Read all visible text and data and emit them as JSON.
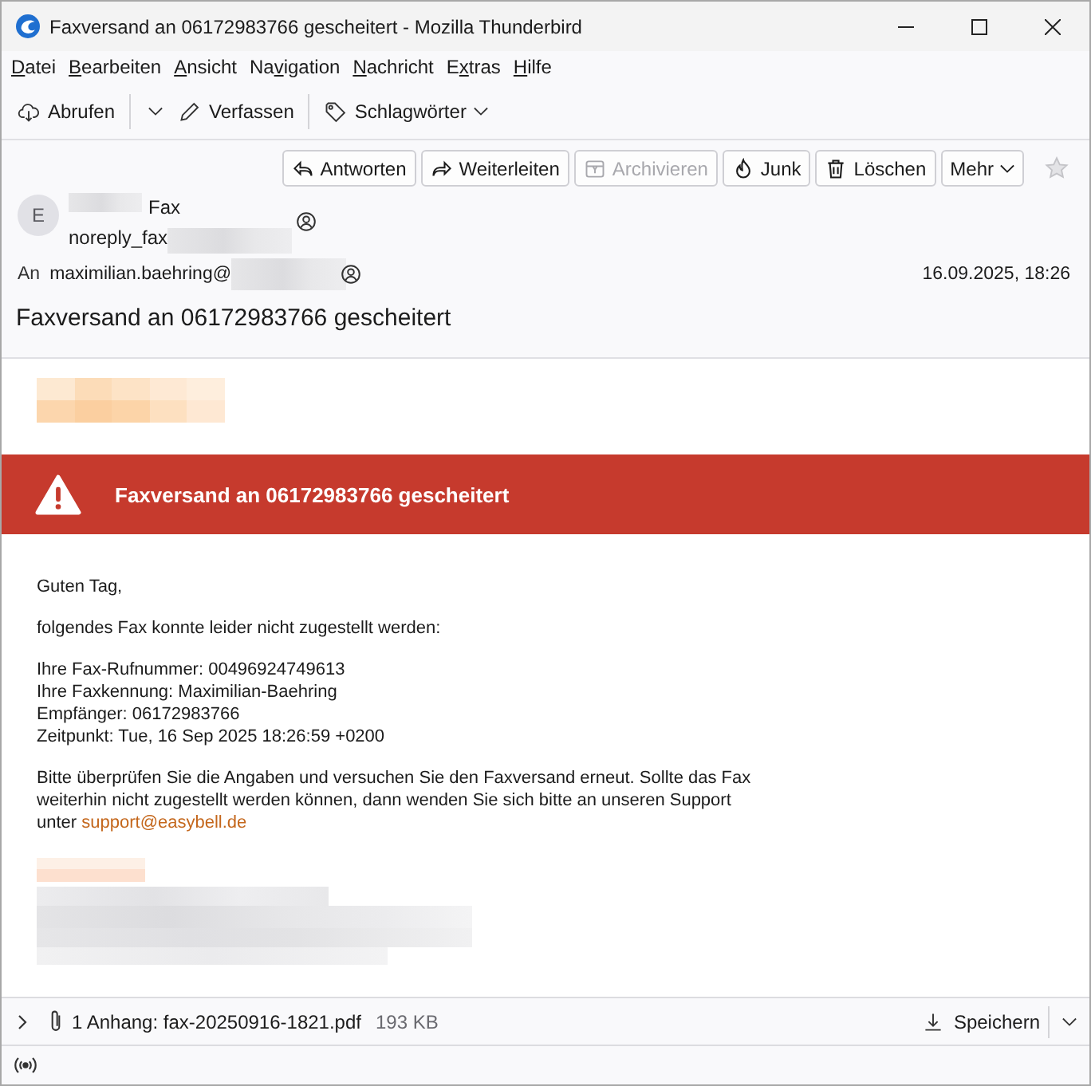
{
  "window": {
    "title": "Faxversand an 06172983766 gescheitert - Mozilla Thunderbird"
  },
  "menu": [
    {
      "key": "D",
      "after": "atei"
    },
    {
      "key": "B",
      "after": "earbeiten"
    },
    {
      "key": "A",
      "after": "nsicht"
    },
    {
      "before": "Na",
      "key": "v",
      "after": "igation"
    },
    {
      "key": "N",
      "after": "achricht"
    },
    {
      "before": "E",
      "key": "x",
      "after": "tras"
    },
    {
      "key": "H",
      "after": "ilfe"
    }
  ],
  "toolbar": [
    {
      "kind": "get",
      "label": "Abrufen"
    },
    {
      "kind": "compose",
      "label": "Verfassen"
    },
    {
      "kind": "tags",
      "label": "Schlagwörter"
    }
  ],
  "header": {
    "actions": [
      {
        "kind": "reply",
        "label": "Antworten",
        "disabled": false
      },
      {
        "kind": "forward",
        "label": "Weiterleiten",
        "disabled": false
      },
      {
        "kind": "archive",
        "label": "Archivieren",
        "disabled": true
      },
      {
        "kind": "junk",
        "label": "Junk",
        "disabled": false
      },
      {
        "kind": "delete",
        "label": "Löschen",
        "disabled": false
      },
      {
        "kind": "more",
        "label": "Mehr",
        "disabled": false
      }
    ],
    "starred": false,
    "from": {
      "avatar": "E",
      "name": "Fax",
      "name_redacted": true,
      "address": "noreply_fax",
      "address_redacted": true
    },
    "to": {
      "label": "An",
      "address": "maximilian.baehring@",
      "address_redacted": true
    },
    "date": "16.09.2025, 18:26",
    "subject": "Faxversand an 06172983766 gescheitert"
  },
  "body": {
    "logo_redacted": true,
    "banner": {
      "title": "Faxversand an 06172983766 gescheitert"
    },
    "greeting": "Guten Tag,",
    "intro": "folgendes Fax konnte leider nicht zugestellt werden:",
    "details": [
      "Ihre Fax-Rufnummer: 00496924749613",
      "Ihre Faxkennung: Maximilian-Baehring",
      "Empfänger: 06172983766",
      "Zeitpunkt: Tue, 16 Sep 2025 18:26:59 +0200"
    ],
    "closing": {
      "text": "Bitte überprüfen Sie die Angaben und versuchen Sie den Faxversand erneut. Sollte das Fax weiterhin nicht zugestellt werden können, dann wenden Sie sich bitte an unseren Support unter ",
      "link": "support@easybell.de"
    },
    "signature_redacted": true
  },
  "attachments": {
    "expanded": false,
    "summary": "1 Anhang: fax-20250916-1821.pdf",
    "size": "193 KB",
    "save_label": "Speichern"
  }
}
